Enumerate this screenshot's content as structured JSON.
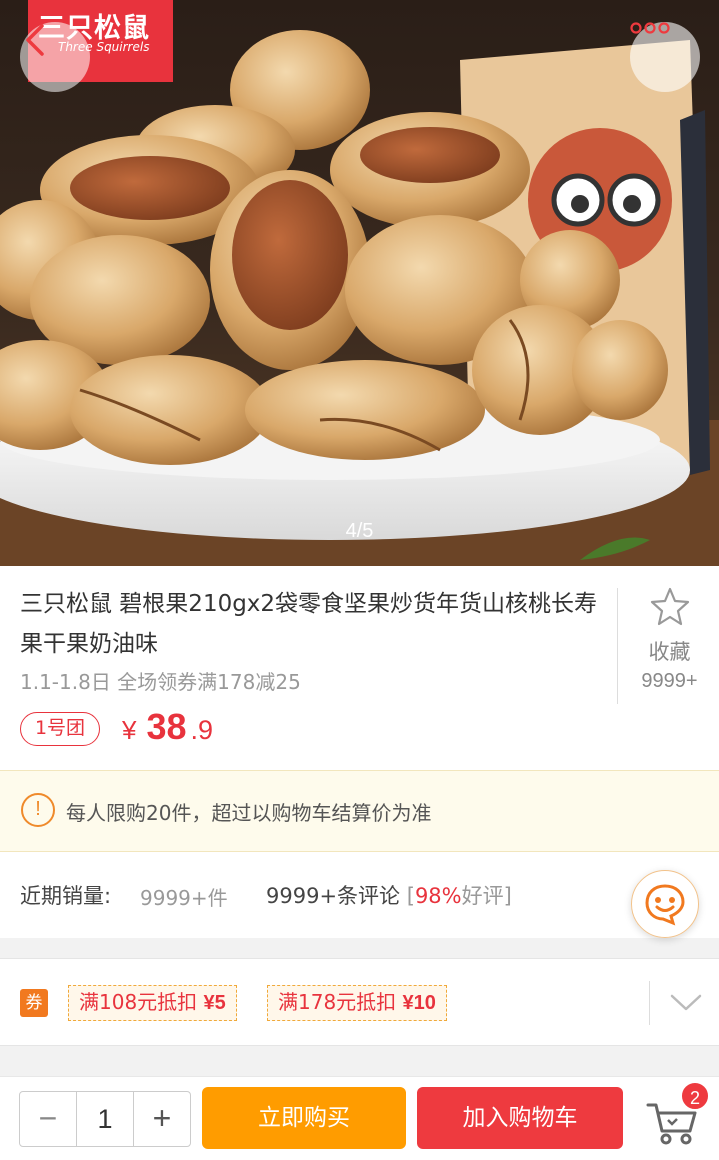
{
  "hero": {
    "brand_cn": "三只松鼠",
    "brand_en": "Three Squirrels",
    "pager": "4/5"
  },
  "product": {
    "title": "三只松鼠 碧根果210gx2袋零食坚果炒货年货山核桃长寿果干果奶油味",
    "promo": "1.1-1.8日 全场领券满178减25",
    "group_tag": "1号团",
    "price_symbol": "¥",
    "price_int": "38",
    "price_dec": ".9",
    "fav_label": "收藏",
    "fav_count": "9999+"
  },
  "notice": {
    "icon_text": "!",
    "text": "每人限购20件，超过以购物车结算价为准"
  },
  "sales": {
    "label": "近期销量:",
    "value": "9999+件",
    "reviews": "9999+条评论",
    "bracket_open": "[",
    "good_pct": "98%",
    "good_label": "好评",
    "bracket_close": "]"
  },
  "coupons": {
    "badge": "券",
    "items": [
      {
        "text": "满108元抵扣",
        "amount": "¥5"
      },
      {
        "text": "满178元抵扣",
        "amount": "¥10"
      }
    ]
  },
  "bottom": {
    "minus": "−",
    "quantity": "1",
    "plus": "+",
    "buy_now": "立即购买",
    "add_cart": "加入购物车",
    "cart_count": "2"
  },
  "colors": {
    "accent_red": "#ee3a3f",
    "buy_orange": "#ff9c00",
    "notice_bg": "#fefbec"
  }
}
